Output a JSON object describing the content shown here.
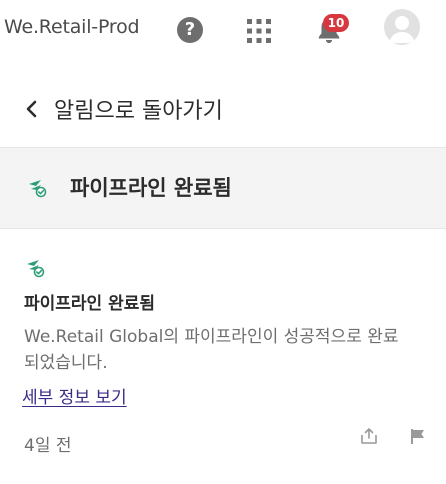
{
  "header": {
    "brand": "We.Retail-Prod",
    "help_icon": "help-icon",
    "apps_icon": "apps-grid-icon",
    "notifications_icon": "bell-icon",
    "notification_count": "10",
    "avatar_icon": "user-avatar-icon",
    "help_glyph": "?"
  },
  "back": {
    "label": "알림으로 돌아가기",
    "icon": "chevron-left-icon"
  },
  "section": {
    "title": "파이프라인 완료됨",
    "icon": "pipeline-complete-icon"
  },
  "notification": {
    "icon": "pipeline-complete-icon",
    "title": "파이프라인 완료됨",
    "description": "We.Retail Global의 파이프라인이 성공적으로 완료되었습니다.",
    "link": "세부 정보 보기",
    "time": "4일 전",
    "actions": [
      "share-icon",
      "flag-icon"
    ]
  },
  "colors": {
    "accent_green": "#2d9d78",
    "badge_red": "#d7373f",
    "link_purple": "#3b2b88"
  }
}
